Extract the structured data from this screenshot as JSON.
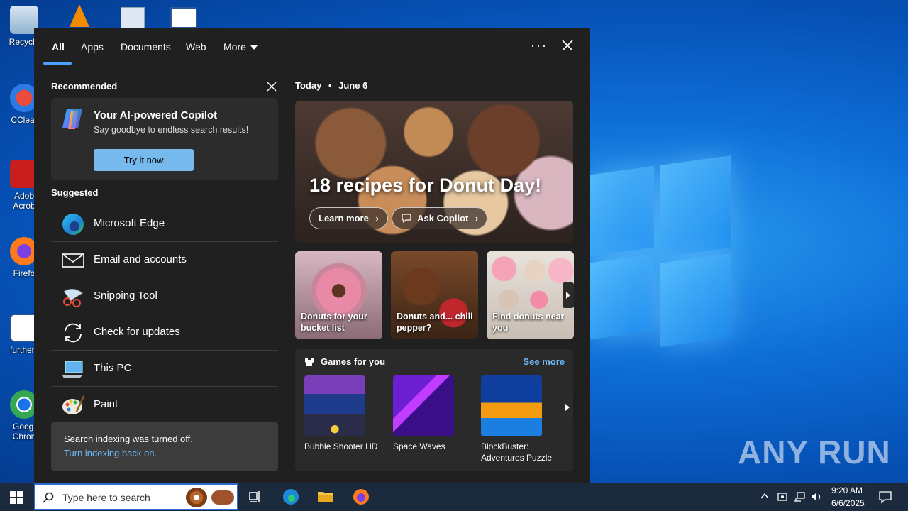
{
  "desktop": {
    "icons": [
      {
        "label": "Recycle"
      },
      {
        "label": "CClear"
      },
      {
        "label": "Adob Acrob"
      },
      {
        "label": "Firefo"
      },
      {
        "label": "furtherli"
      },
      {
        "label": "Googl Chron"
      }
    ],
    "watermark": "ANY RUN"
  },
  "tabs": {
    "all": "All",
    "apps": "Apps",
    "documents": "Documents",
    "web": "Web",
    "more": "More"
  },
  "recommended": {
    "heading": "Recommended",
    "copilot_title": "Your AI-powered Copilot",
    "copilot_sub": "Say goodbye to endless search results!",
    "try_button": "Try it now"
  },
  "suggested": {
    "heading": "Suggested",
    "items": [
      {
        "label": "Microsoft Edge"
      },
      {
        "label": "Email and accounts"
      },
      {
        "label": "Snipping Tool"
      },
      {
        "label": "Check for updates"
      },
      {
        "label": "This PC"
      },
      {
        "label": "Paint"
      }
    ]
  },
  "indexing": {
    "message": "Search indexing was turned off.",
    "link": "Turn indexing back on."
  },
  "today": {
    "label": "Today",
    "separator": "•",
    "date": "June 6"
  },
  "hero": {
    "title": "18 recipes for Donut Day!",
    "learn_more": "Learn more",
    "ask_copilot": "Ask Copilot"
  },
  "tiles": [
    {
      "label": "Donuts for your bucket list"
    },
    {
      "label": "Donuts and... chili pepper?"
    },
    {
      "label": "Find donuts near you"
    }
  ],
  "games": {
    "heading": "Games for you",
    "see_more": "See more",
    "items": [
      {
        "label": "Bubble Shooter HD"
      },
      {
        "label": "Space Waves"
      },
      {
        "label": "BlockBuster: Adventures Puzzle"
      }
    ]
  },
  "taskbar": {
    "search_placeholder": "Type here to search",
    "time": "9:20 AM",
    "date": "6/6/2025"
  }
}
